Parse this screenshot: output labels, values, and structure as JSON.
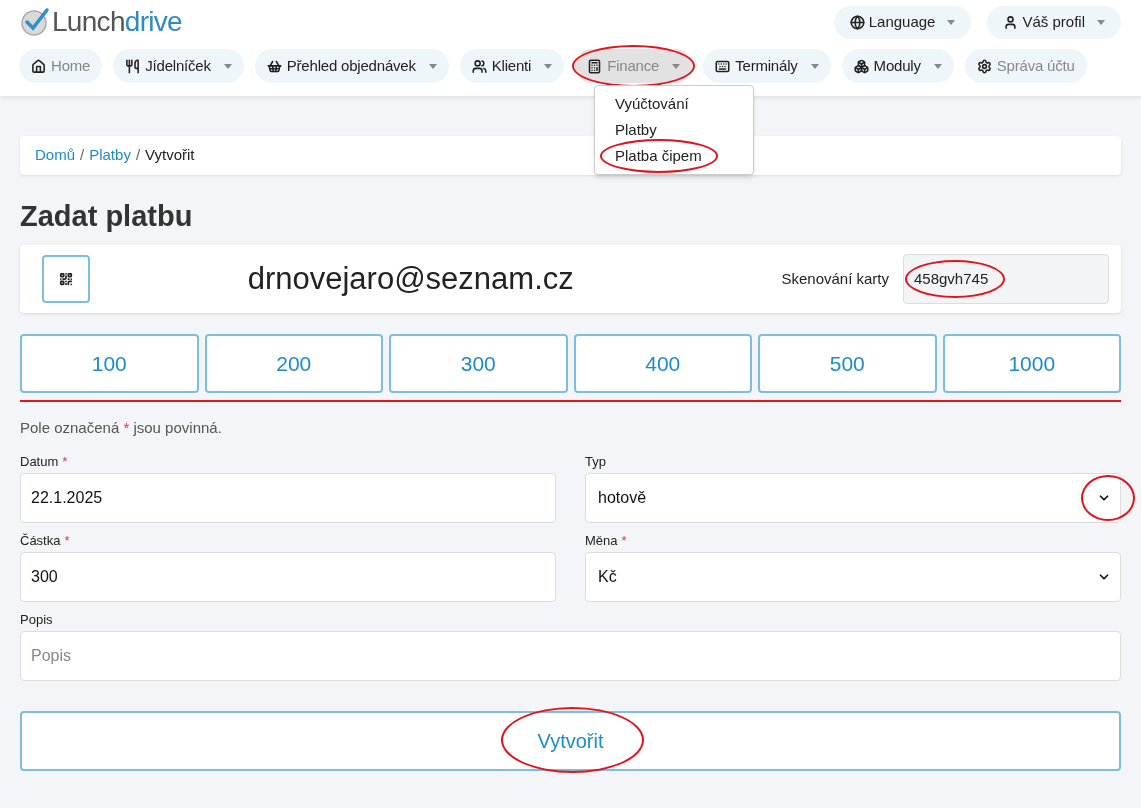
{
  "logo": {
    "part_1": "Lunch",
    "part_2": "drive"
  },
  "top_menu": [
    {
      "label": "Language",
      "kind": "globe"
    },
    {
      "label": "Váš profil",
      "kind": "user"
    }
  ],
  "nav": [
    {
      "label": "Home",
      "kind": "home",
      "dropdown": false,
      "muted": true,
      "selected": false,
      "circled": false
    },
    {
      "label": "Jídelníček",
      "kind": "food",
      "dropdown": true,
      "muted": false,
      "selected": false,
      "circled": false
    },
    {
      "label": "Přehled objednávek",
      "kind": "basket",
      "dropdown": true,
      "muted": false,
      "selected": false,
      "circled": false
    },
    {
      "label": "Klienti",
      "kind": "users",
      "dropdown": true,
      "muted": false,
      "selected": false,
      "circled": false
    },
    {
      "label": "Finance",
      "kind": "register",
      "dropdown": true,
      "muted": true,
      "selected": true,
      "circled": true
    },
    {
      "label": "Terminály",
      "kind": "terminal",
      "dropdown": true,
      "muted": false,
      "selected": false,
      "circled": false
    },
    {
      "label": "Moduly",
      "kind": "boxes",
      "dropdown": true,
      "muted": false,
      "selected": false,
      "circled": false
    },
    {
      "label": "Správa účtu",
      "kind": "gear",
      "dropdown": false,
      "muted": true,
      "selected": false,
      "circled": false
    }
  ],
  "finance_menu": [
    {
      "label": "Vyúčtování",
      "circled": false
    },
    {
      "label": "Platby",
      "circled": false
    },
    {
      "label": "Platba čipem",
      "circled": true
    }
  ],
  "breadcrumb": [
    {
      "label": "Domů",
      "link": true
    },
    {
      "label": "Platby",
      "link": true
    },
    {
      "label": "Vytvořit",
      "link": false
    }
  ],
  "breadcrumb_separator": "/",
  "title": "Zadat platbu",
  "client": {
    "email": "drnovejaro@seznam.cz",
    "card_label": "Skenování karty",
    "card_value": "458gvh745",
    "card_circled": true
  },
  "amounts": [
    "100",
    "200",
    "300",
    "400",
    "500",
    "1000"
  ],
  "required_note": {
    "before": "Pole označená",
    "mark": "*",
    "after": "jsou povinná."
  },
  "fields": [
    {
      "kind": "text",
      "label": "Datum",
      "required_mark": "*",
      "value": "22.1.2025",
      "circled": false
    },
    {
      "kind": "select",
      "label": "Typ",
      "value": "hotově",
      "circled": true
    },
    {
      "kind": "text",
      "label": "Částka",
      "required_mark": "*",
      "value": "300",
      "circled": false
    },
    {
      "kind": "select",
      "label": "Měna",
      "required_mark": "*",
      "value": "Kč",
      "circled": false
    }
  ],
  "description": {
    "label": "Popis",
    "placeholder": "Popis"
  },
  "submit": {
    "label": "Vytvořit",
    "circled": true
  }
}
